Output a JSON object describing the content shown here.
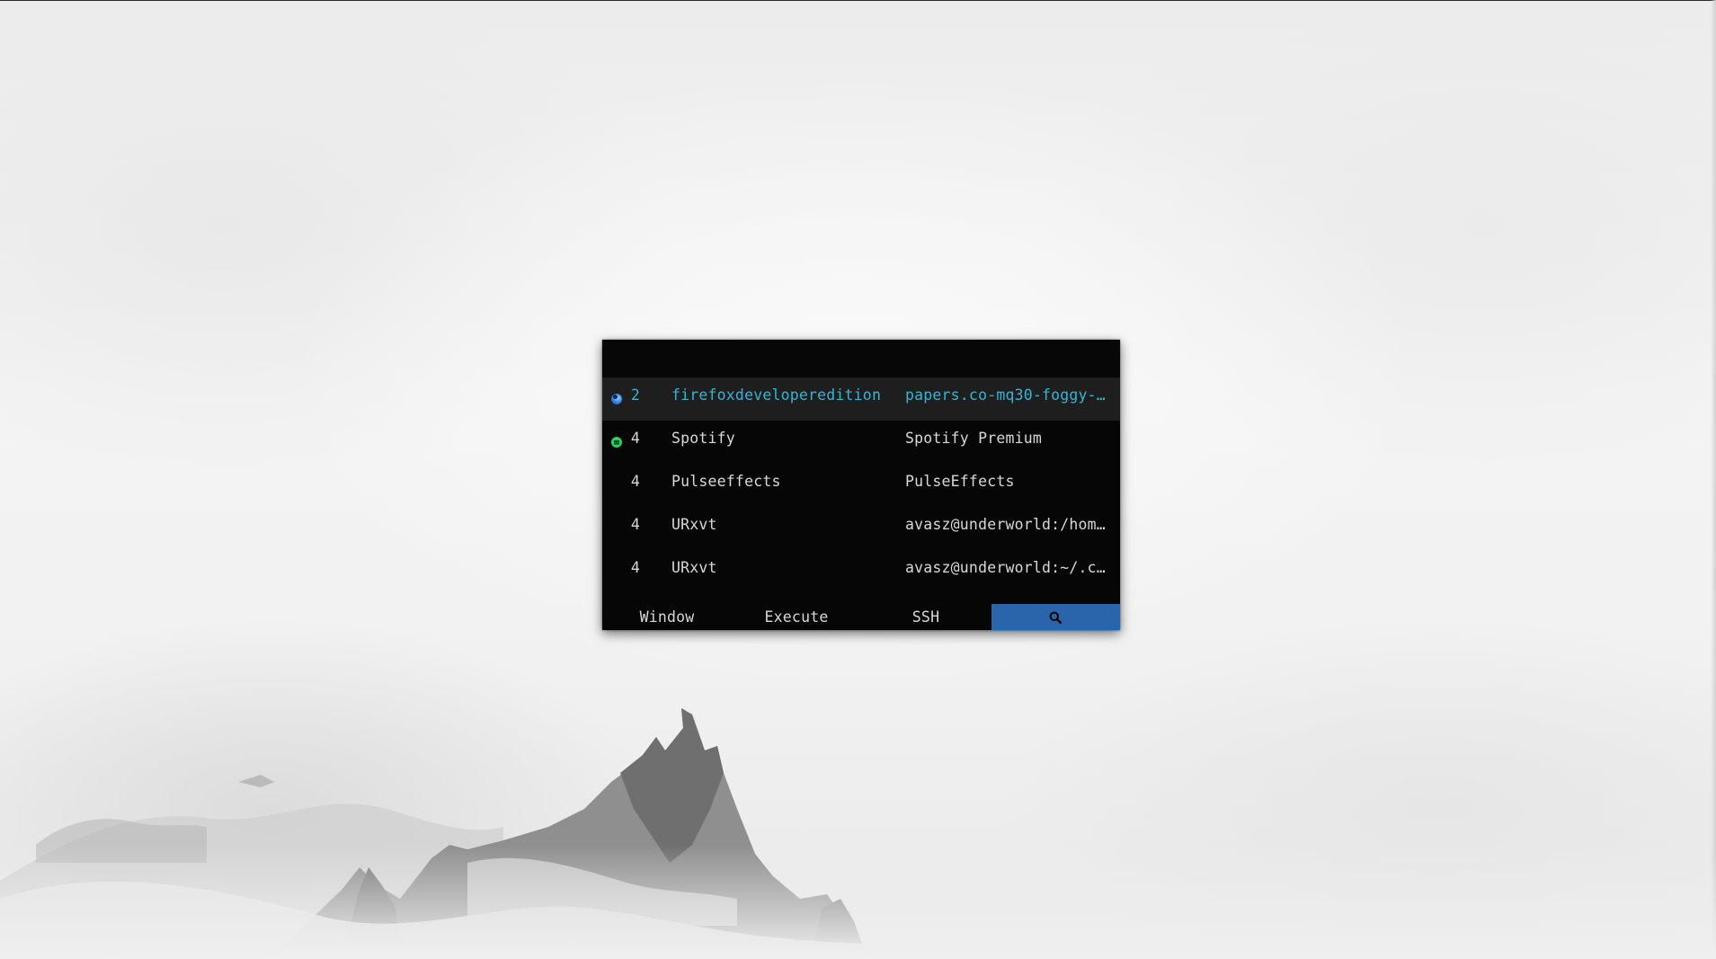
{
  "launcher": {
    "rows": [
      {
        "icon": "firefox-icon",
        "workspace": "2",
        "class": "firefoxdeveloperedition",
        "title": "papers.co-mq30-foggy-…",
        "selected": true
      },
      {
        "icon": "spotify-icon",
        "workspace": "4",
        "class": "Spotify",
        "title": "Spotify Premium",
        "selected": false
      },
      {
        "icon": "",
        "workspace": "4",
        "class": "Pulseeffects",
        "title": "PulseEffects",
        "selected": false
      },
      {
        "icon": "",
        "workspace": "4",
        "class": "URxvt",
        "title": "avasz@underworld:/hom…",
        "selected": false
      },
      {
        "icon": "",
        "workspace": "4",
        "class": "URxvt",
        "title": "avasz@underworld:~/.c…",
        "selected": false
      }
    ],
    "modes": [
      {
        "label": "Window",
        "active": false
      },
      {
        "label": "Execute",
        "active": false
      },
      {
        "label": "SSH",
        "active": false
      },
      {
        "label": "",
        "icon": "search-icon",
        "active": true
      }
    ]
  },
  "colors": {
    "launcher_bg": "#060606",
    "selected_row_bg": "#1e1e1e",
    "selected_text": "#34b5d6",
    "normal_text": "#d8d8d8",
    "active_mode_bg": "#2a64ab"
  }
}
